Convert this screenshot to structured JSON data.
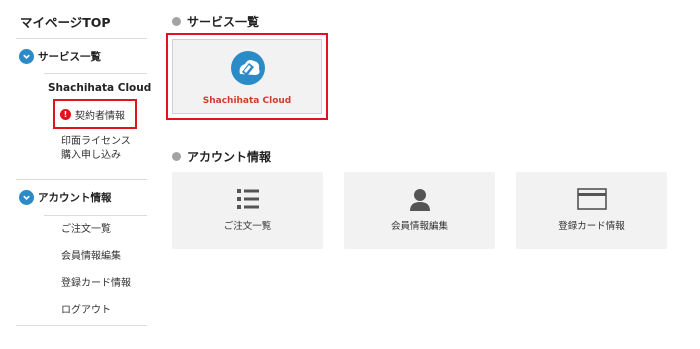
{
  "sidebar": {
    "title": "マイページTOP",
    "services_section": {
      "label": "サービス一覧",
      "cloud_name": "Shachihata Cloud",
      "items": [
        {
          "label": "契約者情報"
        },
        {
          "label": "印面ライセンス\n購入申し込み"
        }
      ]
    },
    "account_section": {
      "label": "アカウント情報",
      "items": [
        {
          "label": "ご注文一覧"
        },
        {
          "label": "会員情報編集"
        },
        {
          "label": "登録カード情報"
        },
        {
          "label": "ログアウト"
        }
      ]
    }
  },
  "main": {
    "services_title": "サービス一覧",
    "service_card": {
      "name": "Shachihata Cloud"
    },
    "account_title": "アカウント情報",
    "account_cards": [
      {
        "label": "ご注文一覧",
        "icon": "list-icon"
      },
      {
        "label": "会員情報編集",
        "icon": "person-icon"
      },
      {
        "label": "登録カード情報",
        "icon": "credit-card-icon"
      }
    ]
  },
  "colors": {
    "accent_blue": "#2a8bc7",
    "highlight_red": "#e0141e",
    "service_name_red": "#d23c2f",
    "card_gray": "#f2f2f2",
    "icon_gray": "#555555"
  }
}
